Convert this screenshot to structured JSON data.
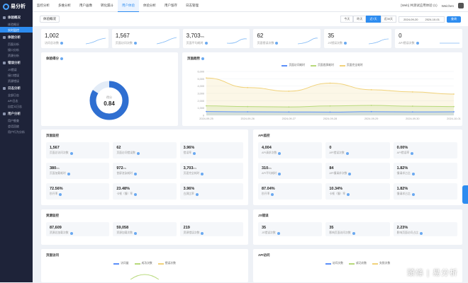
{
  "app": {
    "logo": "易分析"
  },
  "sidebar": {
    "groups": [
      {
        "label": "体验概况",
        "items": [
          "体验概况",
          "实时监控"
        ]
      },
      {
        "label": "体验分析",
        "items": [
          "页面分析",
          "接口分析",
          "资源分析"
        ]
      },
      {
        "label": "错误分析",
        "items": [
          "JS错误",
          "接口错误",
          "资源错误"
        ]
      },
      {
        "label": "日志分析",
        "items": [
          "全部日志",
          "API日志",
          "自定义日志"
        ]
      },
      {
        "label": "用户分析",
        "items": [
          "用户细查",
          "会话回放",
          "用户行为分析"
        ]
      }
    ],
    "active": "实时监控"
  },
  "topbar": {
    "tabs": [
      "监控分析",
      "多维分析",
      "用户画像",
      "转化漏斗",
      "用户体验",
      "体验分析",
      "用户留存",
      "日志管理"
    ],
    "active_tab": "用户体验",
    "app_select": "[Web] 共测试应用体验 (1)",
    "user": "Weichen"
  },
  "toolbar": {
    "crumb": "体验概况",
    "ranges": [
      "今天",
      "昨天",
      "近7天",
      "近30天"
    ],
    "active_range": "近7天",
    "date_start": "2024-09-20",
    "date_end": "2024-10-01",
    "query_label": "查询"
  },
  "kpis": [
    {
      "value": "1,002",
      "unit": "",
      "label": "访问总次数"
    },
    {
      "value": "1,567",
      "unit": "",
      "label": "页面访问次数"
    },
    {
      "value": "3,703",
      "unit": "ms",
      "label": "页面平均耗时"
    },
    {
      "value": "62",
      "unit": "",
      "label": "页面错误次数"
    },
    {
      "value": "35",
      "unit": "",
      "label": "JS错误次数"
    },
    {
      "value": "0",
      "unit": "",
      "label": "API错误次数"
    }
  ],
  "score_panel": {
    "title": "体验得分",
    "gauge_label": "得分",
    "score": "0.84",
    "score_value": 0.84
  },
  "trend_panel": {
    "title": "页面趋势"
  },
  "chart_data": {
    "type": "line",
    "title": "",
    "categories": [
      "2024-09-25",
      "2024-09-26",
      "2024-09-27",
      "2024-09-28",
      "2024-09-29",
      "2024-09-30",
      "2024-10-01"
    ],
    "series": [
      {
        "name": "页面访问耗时",
        "color": "#5b8ff9",
        "values": [
          520,
          480,
          460,
          450,
          500,
          470,
          480
        ]
      },
      {
        "name": "页面首屏耗时",
        "color": "#b7d97a",
        "values": [
          1300,
          1200,
          1150,
          1280,
          1350,
          1250,
          1200
        ]
      },
      {
        "name": "页面完全耗时",
        "color": "#f1d27a",
        "values": [
          5100,
          3800,
          3300,
          4400,
          3500,
          3200,
          2900
        ]
      }
    ],
    "yticks": [
      "0",
      "1,000",
      "2,000",
      "3,000",
      "4,000",
      "5,000",
      "6,000"
    ],
    "ylim": [
      0,
      6000
    ],
    "grid": true,
    "legend": "top"
  },
  "page_section": {
    "title": "页面监控",
    "cells": [
      {
        "value": "1,567",
        "unit": "",
        "label": "页面总访问次数"
      },
      {
        "value": "62",
        "unit": "",
        "label": "页面访问错误数"
      },
      {
        "value": "3.96%",
        "unit": "",
        "label": "错误率"
      },
      {
        "value": "380",
        "unit": "ms",
        "label": "页面加载耗时"
      },
      {
        "value": "972",
        "unit": "ms",
        "label": "首屏渲染耗时"
      },
      {
        "value": "3,703",
        "unit": "ms",
        "label": "页面完全耗时"
      },
      {
        "value": "72.56%",
        "unit": "",
        "label": "秒开率"
      },
      {
        "value": "23.48%",
        "unit": "",
        "label": "卡顿（慢）率"
      },
      {
        "value": "3.96%",
        "unit": "",
        "label": "白屏比率"
      }
    ]
  },
  "api_section": {
    "title": "API监控",
    "cells": [
      {
        "value": "4,004",
        "unit": "",
        "label": "API请求次数"
      },
      {
        "value": "0",
        "unit": "",
        "label": "API错误次数"
      },
      {
        "value": "0.00%",
        "unit": "",
        "label": "API错误率"
      },
      {
        "value": "310",
        "unit": "ms",
        "label": "API平均耗时"
      },
      {
        "value": "84",
        "unit": "",
        "label": "API慢请求次数"
      },
      {
        "value": "1.82%",
        "unit": "",
        "label": "慢请求占比"
      },
      {
        "value": "87.04%",
        "unit": "",
        "label": "秒开率"
      },
      {
        "value": "10.34%",
        "unit": "",
        "label": "卡顿（慢）率"
      },
      {
        "value": "1.82%",
        "unit": "",
        "label": "慢请求占比"
      }
    ]
  },
  "resource_section": {
    "title": "资源监控",
    "cells": [
      {
        "value": "87,609",
        "unit": "",
        "label": "资源总加载次数"
      },
      {
        "value": "59,058",
        "unit": "",
        "label": "资源加载次数"
      },
      {
        "value": "219",
        "unit": "",
        "label": "资源错误次数"
      }
    ]
  },
  "error_section": {
    "title": "JS错误",
    "cells": [
      {
        "value": "35",
        "unit": "",
        "label": "JS错误次数"
      },
      {
        "value": "35",
        "unit": "",
        "label": "影响页面访问次数"
      },
      {
        "value": "2.23%",
        "unit": "",
        "label": "影响页面访问占比"
      }
    ]
  },
  "bottom_left": {
    "title": "页面访问",
    "legend": [
      "访问量",
      "成功次数",
      "错误次数"
    ]
  },
  "bottom_right": {
    "title": "API访问",
    "legend": [
      "访问次数",
      "成功次数",
      "失败次数"
    ]
  },
  "watermark": "頭條 | 易分析"
}
